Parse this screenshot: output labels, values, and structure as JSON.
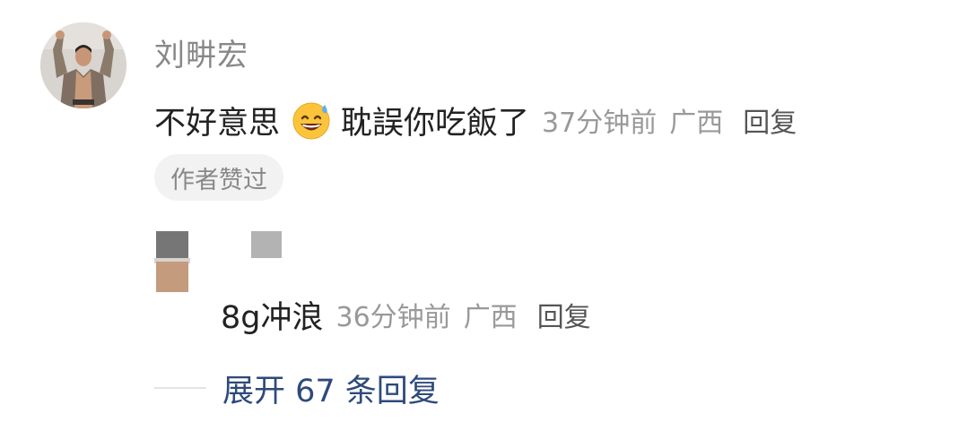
{
  "comment": {
    "author": "刘畊宏",
    "text_before_emoji": "不好意思",
    "emoji": "grinning-sweat-emoji",
    "text_after_emoji": "耽誤你吃飯了",
    "time": "37分钟前",
    "location": "广西",
    "reply_label": "回复",
    "author_liked_badge": "作者赞过"
  },
  "reply": {
    "text": "8g冲浪",
    "time": "36分钟前",
    "location": "广西",
    "reply_label": "回复"
  },
  "expand": {
    "label": "展开 67 条回复"
  },
  "colors": {
    "primary_text": "#222222",
    "secondary_text": "#999999",
    "link": "#2e4a7a",
    "badge_bg": "#f2f2f2"
  }
}
